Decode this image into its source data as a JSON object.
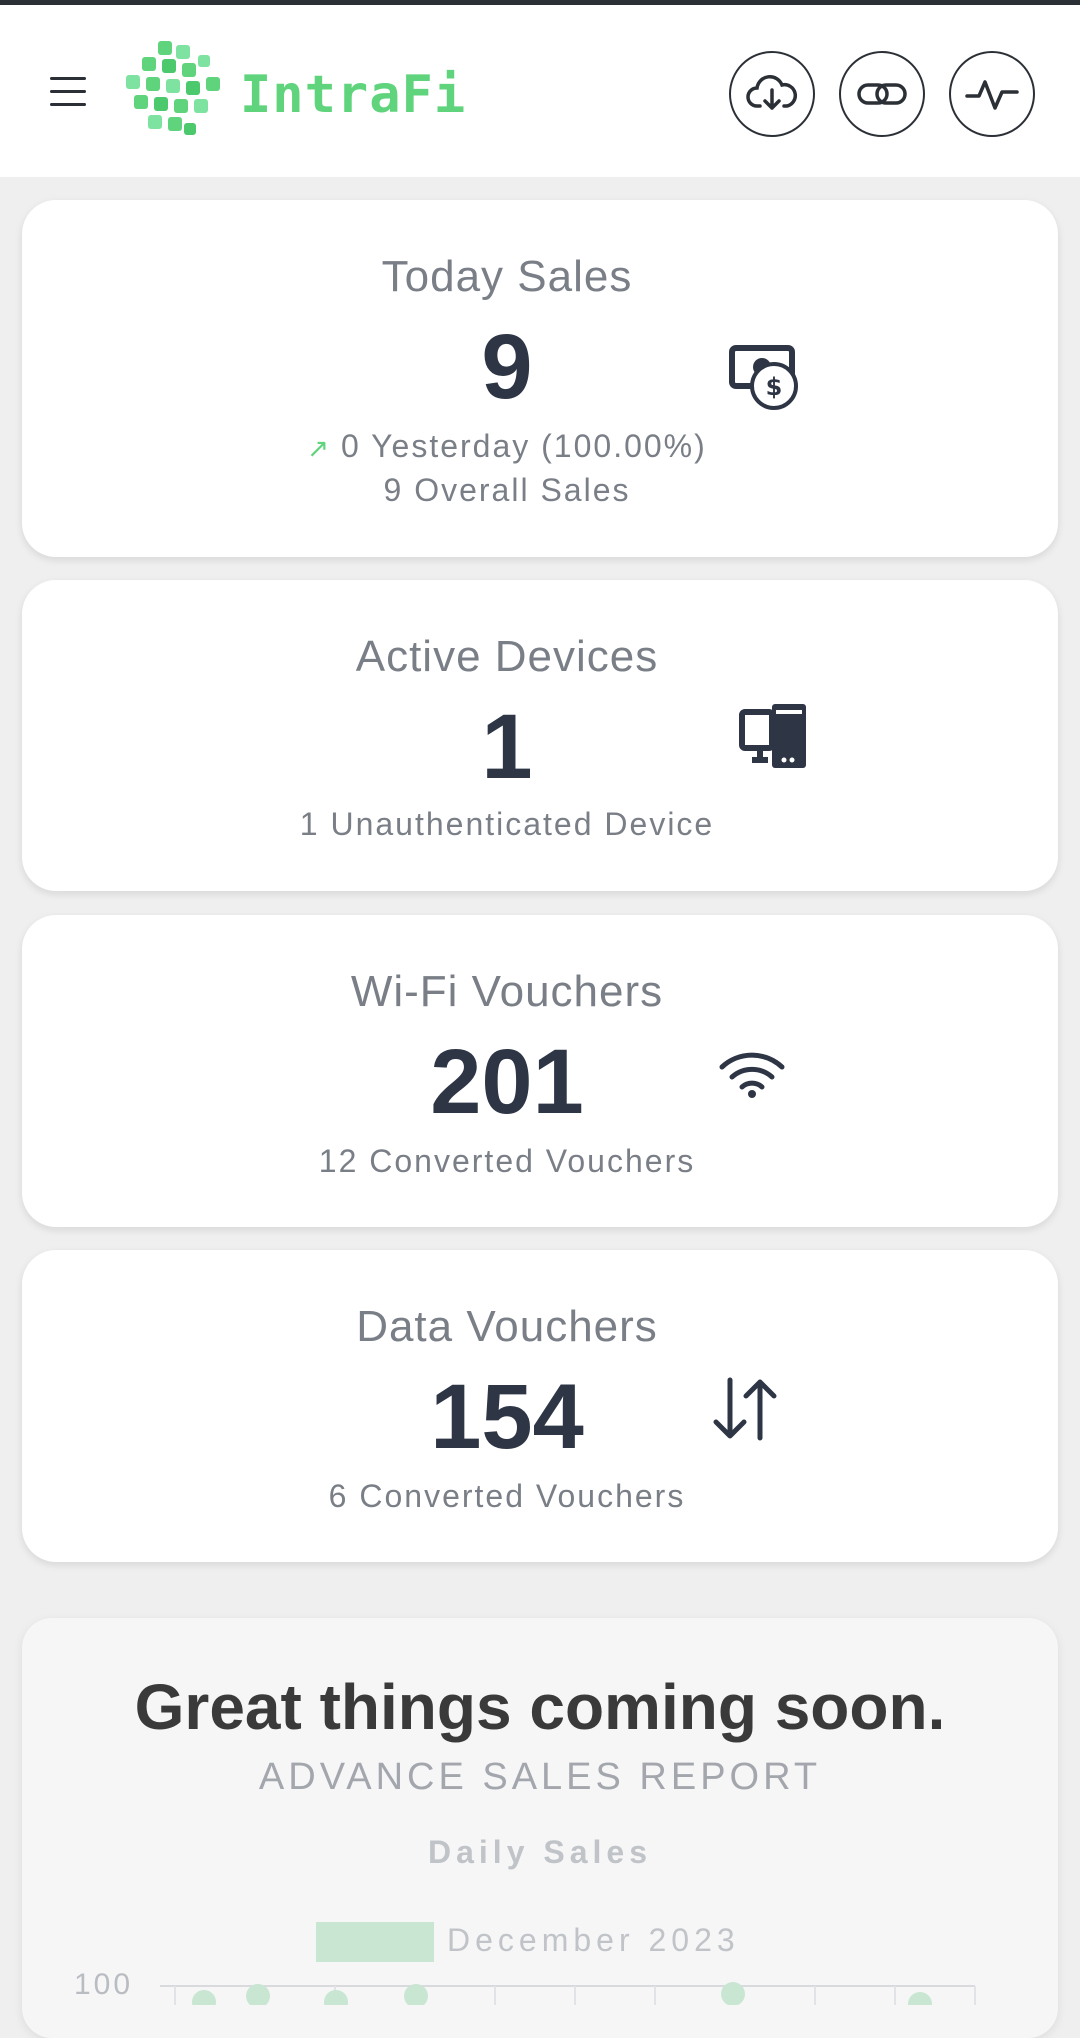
{
  "header": {
    "brand": "IntraFi",
    "buttons": [
      {
        "name": "download-button",
        "icon": "cloud-download-icon"
      },
      {
        "name": "link-button",
        "icon": "link-icon"
      },
      {
        "name": "activity-button",
        "icon": "activity-pulse-icon"
      }
    ],
    "brand_color": "#5fd47c"
  },
  "cards": {
    "today_sales": {
      "title": "Today Sales",
      "value": "9",
      "yesterday": "0 Yesterday (100.00%)",
      "overall": "9 Overall Sales",
      "icon": "money-bill-dollar-icon"
    },
    "active_devices": {
      "title": "Active Devices",
      "value": "1",
      "sub": "1 Unauthenticated Device",
      "icon": "devices-icon"
    },
    "wifi_vouchers": {
      "title": "Wi-Fi Vouchers",
      "value": "201",
      "sub": "12 Converted Vouchers",
      "icon": "wifi-icon"
    },
    "data_vouchers": {
      "title": "Data Vouchers",
      "value": "154",
      "sub": "6 Converted Vouchers",
      "icon": "transfer-arrows-icon"
    }
  },
  "report": {
    "headline": "Great things coming soon.",
    "subtitle": "ADVANCE SALES REPORT"
  },
  "chart_data": {
    "type": "line",
    "title": "Daily Sales",
    "legend": [
      "December 2023"
    ],
    "legend_color": "#c9e6d2",
    "y_tick_visible": "100",
    "ylim": [
      0,
      100
    ],
    "series": [
      {
        "name": "December 2023",
        "values": [
          100,
          100,
          100,
          100,
          100,
          100
        ]
      }
    ]
  }
}
